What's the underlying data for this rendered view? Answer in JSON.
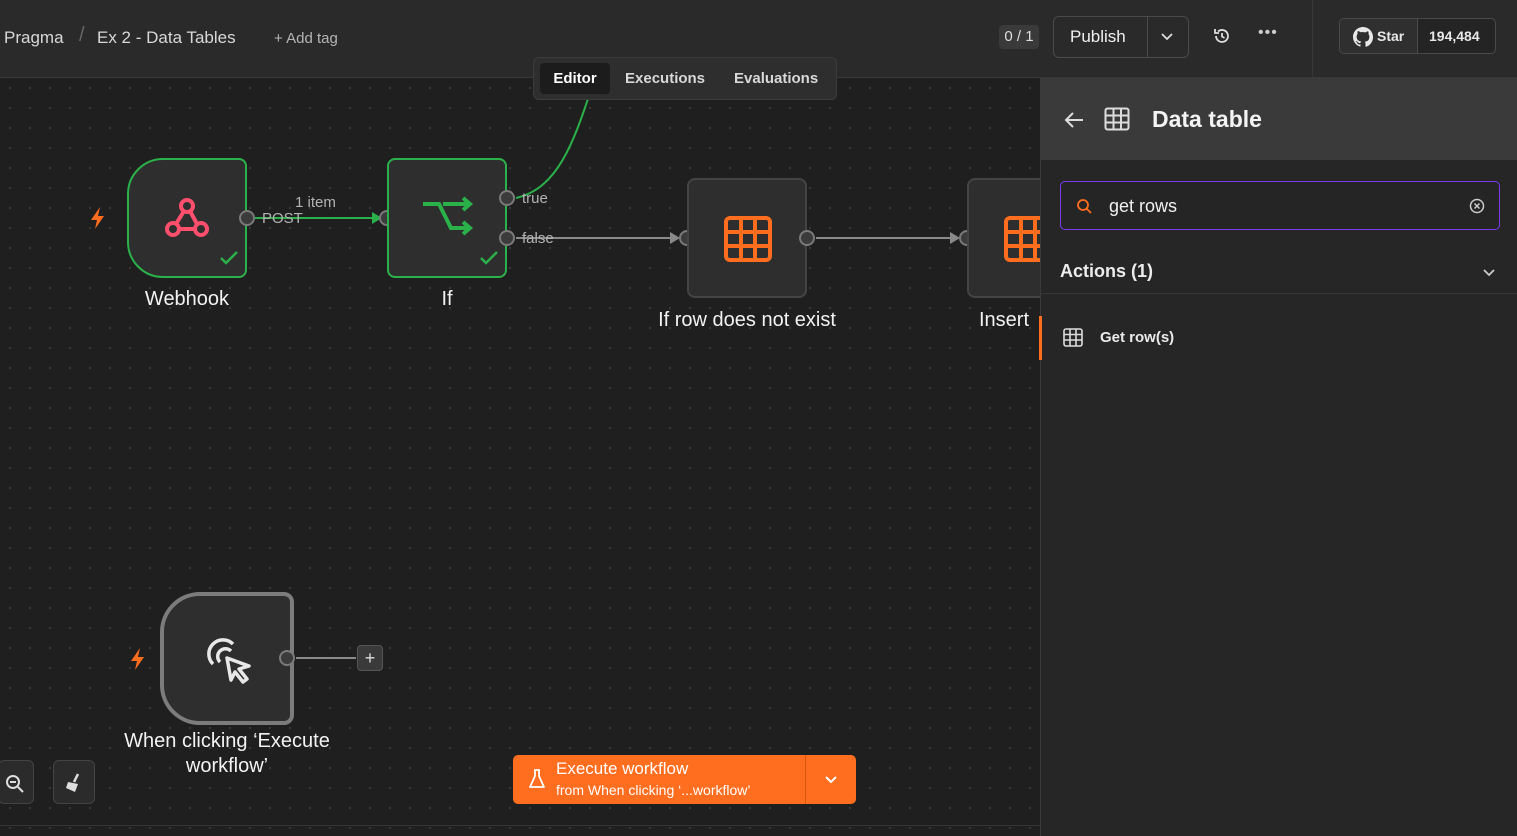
{
  "header": {
    "project": "Pragma",
    "workflow_name": "Ex 2 - Data Tables",
    "add_tag": "+ Add tag",
    "counter": "0 / 1",
    "publish_label": "Publish",
    "github_star": "Star",
    "github_count": "194,484"
  },
  "tabs": [
    {
      "label": "Editor",
      "active": true
    },
    {
      "label": "Executions",
      "active": false
    },
    {
      "label": "Evaluations",
      "active": false
    }
  ],
  "canvas": {
    "nodes": {
      "webhook": "Webhook",
      "if": "If",
      "if_row": "If row does not exist",
      "insert": "Insert",
      "manual": "When clicking ‘Execute workflow’"
    },
    "edges": {
      "item_count": "1 item",
      "post": "POST",
      "true": "true",
      "false": "false"
    },
    "execute": {
      "label": "Execute workflow",
      "sub": "from When clicking ‘...workflow’"
    },
    "colors": {
      "success": "#2bb14a",
      "accent": "#ff6d1f",
      "webhook": "#ff4f6d"
    }
  },
  "panel": {
    "title": "Data table",
    "search_value": "get rows",
    "section": "Actions (1)",
    "items": [
      {
        "label": "Get row(s)",
        "icon": "table-icon"
      }
    ],
    "accent": "#7c3aed"
  }
}
